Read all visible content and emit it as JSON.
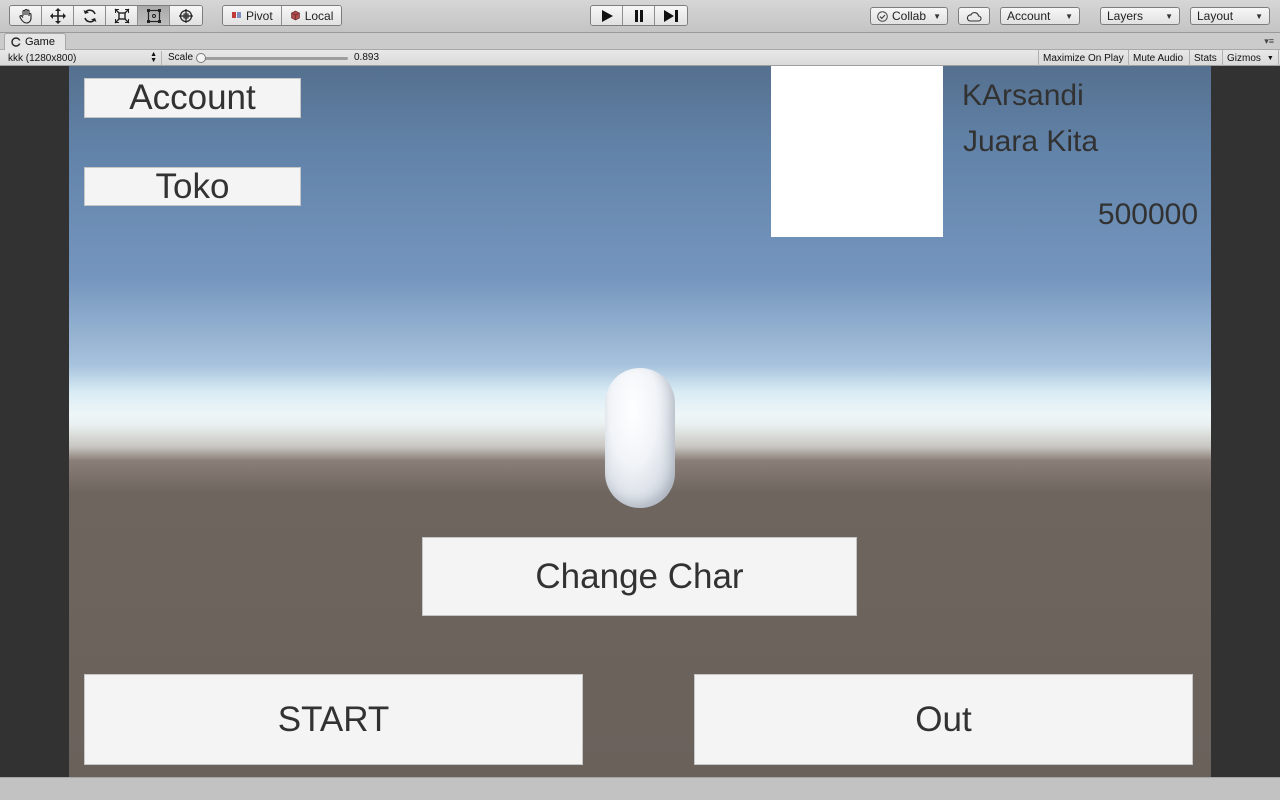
{
  "toolbar": {
    "handle_tools": [
      {
        "name": "hand-tool-icon",
        "active": false
      },
      {
        "name": "move-tool-icon",
        "active": false
      },
      {
        "name": "rotate-tool-icon",
        "active": false
      },
      {
        "name": "scale-tool-icon",
        "active": false
      },
      {
        "name": "rect-tool-icon",
        "active": true
      },
      {
        "name": "transform-tool-icon",
        "active": false
      }
    ],
    "pivot_label": "Pivot",
    "local_label": "Local",
    "play_icon": "play-icon",
    "pause_icon": "pause-icon",
    "step_icon": "step-icon",
    "collab_label": "Collab",
    "cloud_icon": "cloud-icon",
    "account_label": "Account",
    "layers_label": "Layers",
    "layout_label": "Layout"
  },
  "panel": {
    "tab_title": "Game",
    "resolution": "kkk (1280x800)",
    "scale_label": "Scale",
    "scale_value": "0.893",
    "scale_fraction": 0.0,
    "maximize_on_play": "Maximize On Play",
    "mute_audio": "Mute Audio",
    "stats": "Stats",
    "gizmos": "Gizmos"
  },
  "game": {
    "account_button": "Account",
    "toko_button": "Toko",
    "player_name": "KArsandi",
    "player_title": "Juara Kita",
    "coins": "500000",
    "change_char_button": "Change Char",
    "start_button": "START",
    "out_button": "Out"
  }
}
